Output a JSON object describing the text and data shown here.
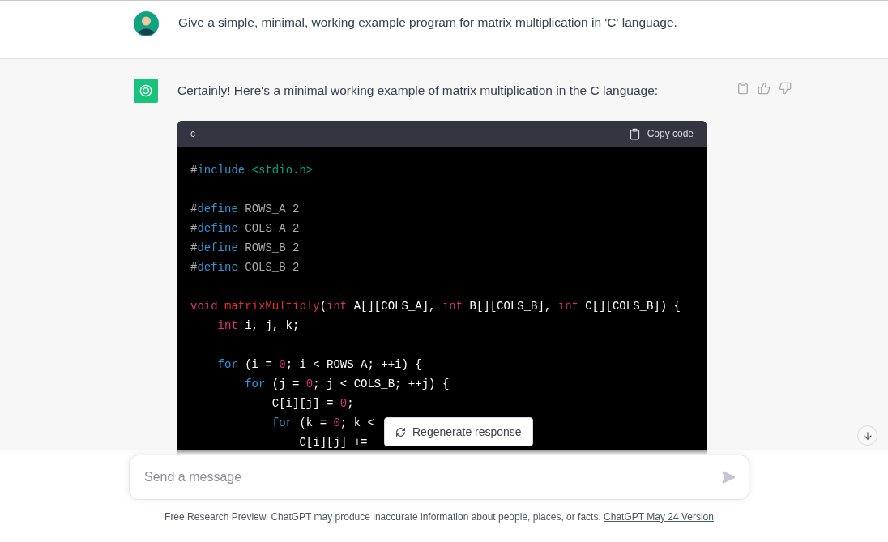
{
  "user_message": {
    "text": "Give a simple, minimal, working example program for matrix multiplication in 'C' language."
  },
  "assistant_message": {
    "text": "Certainly! Here's a minimal working example of matrix multiplication in the C language:",
    "code_block": {
      "language": "c",
      "copy_label": "Copy code",
      "lines": [
        {
          "kind": "code",
          "tokens": [
            {
              "kind": "punct",
              "t": "#"
            },
            {
              "kind": "keyword",
              "t": "include"
            },
            {
              "kind": "string",
              "t": " <stdio.h>"
            }
          ]
        },
        {
          "kind": "blank"
        },
        {
          "kind": "code",
          "tokens": [
            {
              "kind": "punct",
              "t": "#"
            },
            {
              "kind": "keyword",
              "t": "define"
            },
            {
              "kind": "macro",
              "t": " ROWS_A 2"
            }
          ]
        },
        {
          "kind": "code",
          "tokens": [
            {
              "kind": "punct",
              "t": "#"
            },
            {
              "kind": "keyword",
              "t": "define"
            },
            {
              "kind": "macro",
              "t": " COLS_A 2"
            }
          ]
        },
        {
          "kind": "code",
          "tokens": [
            {
              "kind": "punct",
              "t": "#"
            },
            {
              "kind": "keyword",
              "t": "define"
            },
            {
              "kind": "macro",
              "t": " ROWS_B 2"
            }
          ]
        },
        {
          "kind": "code",
          "tokens": [
            {
              "kind": "punct",
              "t": "#"
            },
            {
              "kind": "keyword",
              "t": "define"
            },
            {
              "kind": "macro",
              "t": " COLS_B 2"
            }
          ]
        },
        {
          "kind": "blank"
        },
        {
          "kind": "code",
          "tokens": [
            {
              "kind": "type",
              "t": "void"
            },
            {
              "kind": "function",
              "t": " matrixMultiply"
            },
            {
              "kind": "plain",
              "t": "("
            },
            {
              "kind": "type",
              "t": "int"
            },
            {
              "kind": "plain",
              "t": " A[][COLS_A], "
            },
            {
              "kind": "type",
              "t": "int"
            },
            {
              "kind": "plain",
              "t": " B[][COLS_B], "
            },
            {
              "kind": "type",
              "t": "int"
            },
            {
              "kind": "plain",
              "t": " C[][COLS_B]) {"
            }
          ]
        },
        {
          "kind": "code",
          "tokens": [
            {
              "kind": "type",
              "t": "    int"
            },
            {
              "kind": "plain",
              "t": " i, j, k;"
            }
          ]
        },
        {
          "kind": "blank"
        },
        {
          "kind": "code",
          "tokens": [
            {
              "kind": "keyword",
              "t": "    for"
            },
            {
              "kind": "plain",
              "t": " (i = "
            },
            {
              "kind": "number",
              "t": "0"
            },
            {
              "kind": "plain",
              "t": "; i < ROWS_A; ++i) {"
            }
          ]
        },
        {
          "kind": "code",
          "tokens": [
            {
              "kind": "keyword",
              "t": "        for"
            },
            {
              "kind": "plain",
              "t": " (j = "
            },
            {
              "kind": "number",
              "t": "0"
            },
            {
              "kind": "plain",
              "t": "; j < COLS_B; ++j) {"
            }
          ]
        },
        {
          "kind": "code",
          "tokens": [
            {
              "kind": "plain",
              "t": "            C[i][j] = "
            },
            {
              "kind": "number",
              "t": "0"
            },
            {
              "kind": "plain",
              "t": ";"
            }
          ]
        },
        {
          "kind": "code",
          "tokens": [
            {
              "kind": "keyword",
              "t": "            for"
            },
            {
              "kind": "plain",
              "t": " (k = "
            },
            {
              "kind": "number",
              "t": "0"
            },
            {
              "kind": "plain",
              "t": "; k <"
            }
          ]
        },
        {
          "kind": "code",
          "tokens": [
            {
              "kind": "plain",
              "t": "                C[i][j] +="
            }
          ]
        }
      ]
    }
  },
  "regenerate_button": {
    "label": "Regenerate response"
  },
  "composer": {
    "placeholder": "Send a message"
  },
  "footer": {
    "text": "Free Research Preview. ChatGPT may produce inaccurate information about people, places, or facts.",
    "link": "ChatGPT May 24 Version"
  }
}
